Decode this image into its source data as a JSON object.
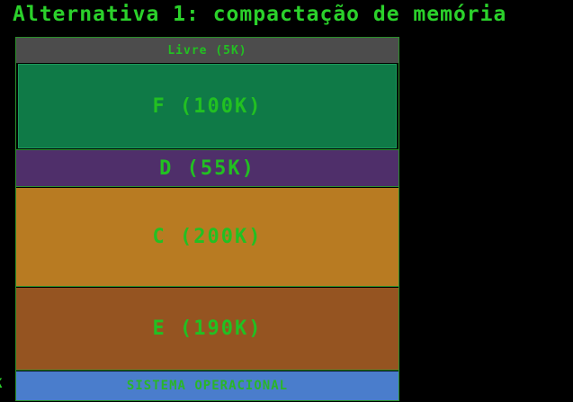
{
  "title": "Alternativa 1: compactação de memória",
  "memory": {
    "blocks": [
      {
        "label": "Livre (5K)",
        "color": "#4c4c4c"
      },
      {
        "label": "F (100K)",
        "color": "#0f7a47"
      },
      {
        "label": "D (55K)",
        "color": "#4f2f6a"
      },
      {
        "label": "C (200K)",
        "color": "#b87b22"
      },
      {
        "label": "E (190K)",
        "color": "#955421"
      },
      {
        "label": "SISTEMA OPERACIONAL",
        "color": "#4a7dcc"
      }
    ]
  },
  "edge_label": "K",
  "text_color": "#2bd12b"
}
